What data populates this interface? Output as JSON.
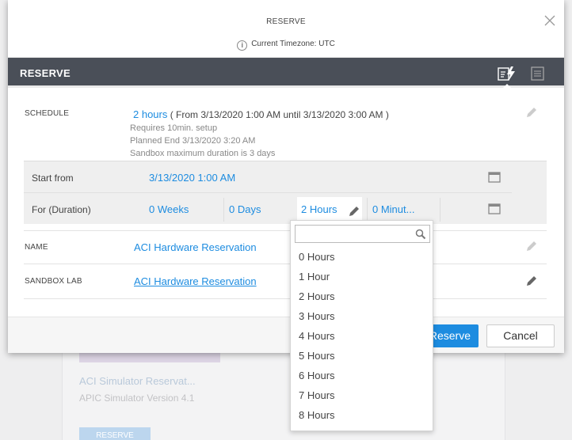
{
  "background": {
    "card_title": "ACI Simulator Reservat...",
    "card_subtitle": "APIC Simulator Version 4.1",
    "card_button": "RESERVE"
  },
  "modal": {
    "title": "RESERVE",
    "timezone": "Current Timezone: UTC",
    "header_title": "RESERVE",
    "schedule": {
      "label": "SCHEDULE",
      "duration": "2 hours",
      "range": "( From 3/13/2020 1:00 AM until 3/13/2020 3:00 AM )",
      "setup_note": "Requires 10min. setup",
      "planned_end": "Planned End 3/13/2020 3:20 AM",
      "max_duration": "Sandbox maximum duration is 3 days"
    },
    "start_from": {
      "label": "Start from",
      "value": "3/13/2020 1:00 AM"
    },
    "duration": {
      "label": "For (Duration)",
      "weeks": "0 Weeks",
      "days": "0 Days",
      "hours": "2 Hours",
      "minutes": "0 Minut..."
    },
    "name": {
      "label": "NAME",
      "value": "ACI Hardware Reservation"
    },
    "sandbox_lab": {
      "label": "SANDBOX LAB",
      "value": "ACI Hardware Reservation"
    },
    "footer": {
      "reserve_label": "Reserve",
      "cancel_label": "Cancel"
    }
  },
  "hours_dropdown": {
    "search_placeholder": "",
    "options": [
      "0 Hours",
      "1 Hour",
      "2 Hours",
      "3 Hours",
      "4 Hours",
      "5 Hours",
      "6 Hours",
      "7 Hours",
      "8 Hours"
    ]
  },
  "colors": {
    "accent": "#1d8ce0",
    "header_bg": "#4a4f58"
  }
}
